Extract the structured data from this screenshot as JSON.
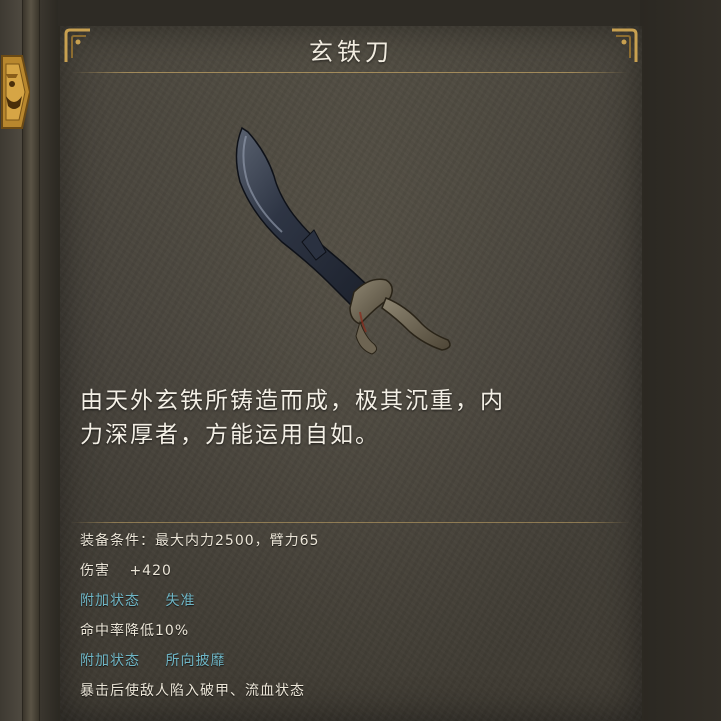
{
  "item": {
    "name": "玄铁刀",
    "description_lines": [
      "由天外玄铁所铸造而成，极其沉重，内",
      "力深厚者，方能运用自如。"
    ]
  },
  "stats": {
    "requirement": "装备条件：最大内力2500，臂力65",
    "damage_label": "伤害",
    "damage_value": "+420",
    "effects": [
      {
        "label": "附加状态",
        "name": "失准",
        "detail": "命中率降低10%"
      },
      {
        "label": "附加状态",
        "name": "所向披靡",
        "detail": "暴击后使敌人陷入破甲、流血状态"
      }
    ]
  },
  "icons": {
    "emblem": "demon-mask-emblem-icon",
    "corner_left": "ornate-corner-icon",
    "corner_right": "ornate-corner-icon",
    "weapon": "black-iron-blade-icon"
  },
  "colors": {
    "panel": "#45413a",
    "title_text": "#f1ece0",
    "effect_text": "#6fb6c6",
    "gold_accent": "#c8a050"
  }
}
